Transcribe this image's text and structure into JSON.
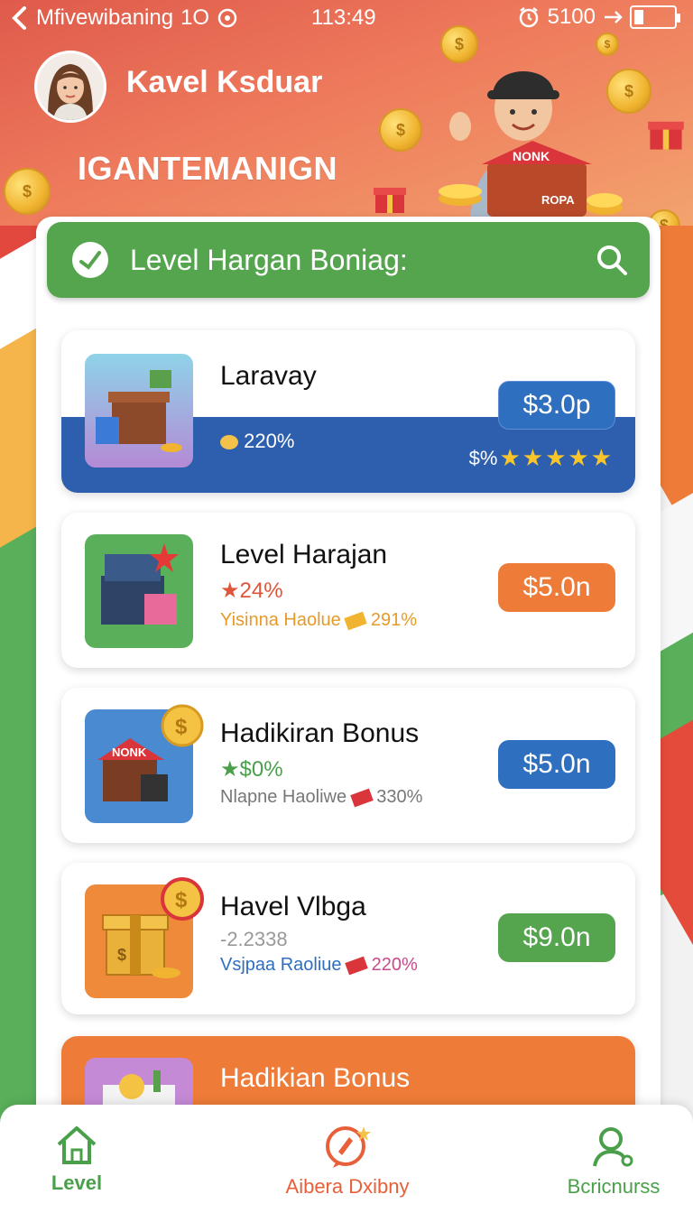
{
  "status_bar": {
    "carrier": "Mfivewibaning",
    "signal_text": "1O",
    "time": "113:49",
    "alarm_text": "5100"
  },
  "profile": {
    "name": "Kavel Ksduar"
  },
  "brand": "IGANTEMANIGN",
  "search": {
    "title": "Level Hargan Boniag:"
  },
  "cards": [
    {
      "title": "Laravay",
      "line1": "220%",
      "line2": "",
      "price": "$3.0p",
      "rating_prefix": "$%",
      "rating_stars": 5,
      "accent": "#2e5fae"
    },
    {
      "title": "Level Harajan",
      "line1": "24%",
      "line2_prefix": "Yisinna Haolue",
      "line2_value": "291%",
      "price": "$5.0n",
      "accent": "#ee7c38"
    },
    {
      "title": "Hadikiran Bonus",
      "line1": "$0%",
      "line2_prefix": "Nlapne Haoliwe",
      "line2_value": "330%",
      "price": "$5.0n",
      "accent": "#2e6fbf"
    },
    {
      "title": "Havel Vlbga",
      "line1": "-2.2338",
      "line2_prefix": "Vsjpaa Raoliue",
      "line2_value": "220%",
      "price": "$9.0n",
      "accent": "#55a54e"
    },
    {
      "title": "Hadikian Bonus",
      "accent": "#ee7c38"
    }
  ],
  "nav": [
    {
      "label": "Level",
      "active": true
    },
    {
      "label": "Aibera Dxibny",
      "active": false
    },
    {
      "label": "Bcricnurss",
      "active": false
    }
  ],
  "colors": {
    "header_start": "#df5a4b",
    "header_end": "#f3a36e",
    "green": "#55a54e",
    "blue": "#2e5fae",
    "orange": "#ee7c38"
  }
}
